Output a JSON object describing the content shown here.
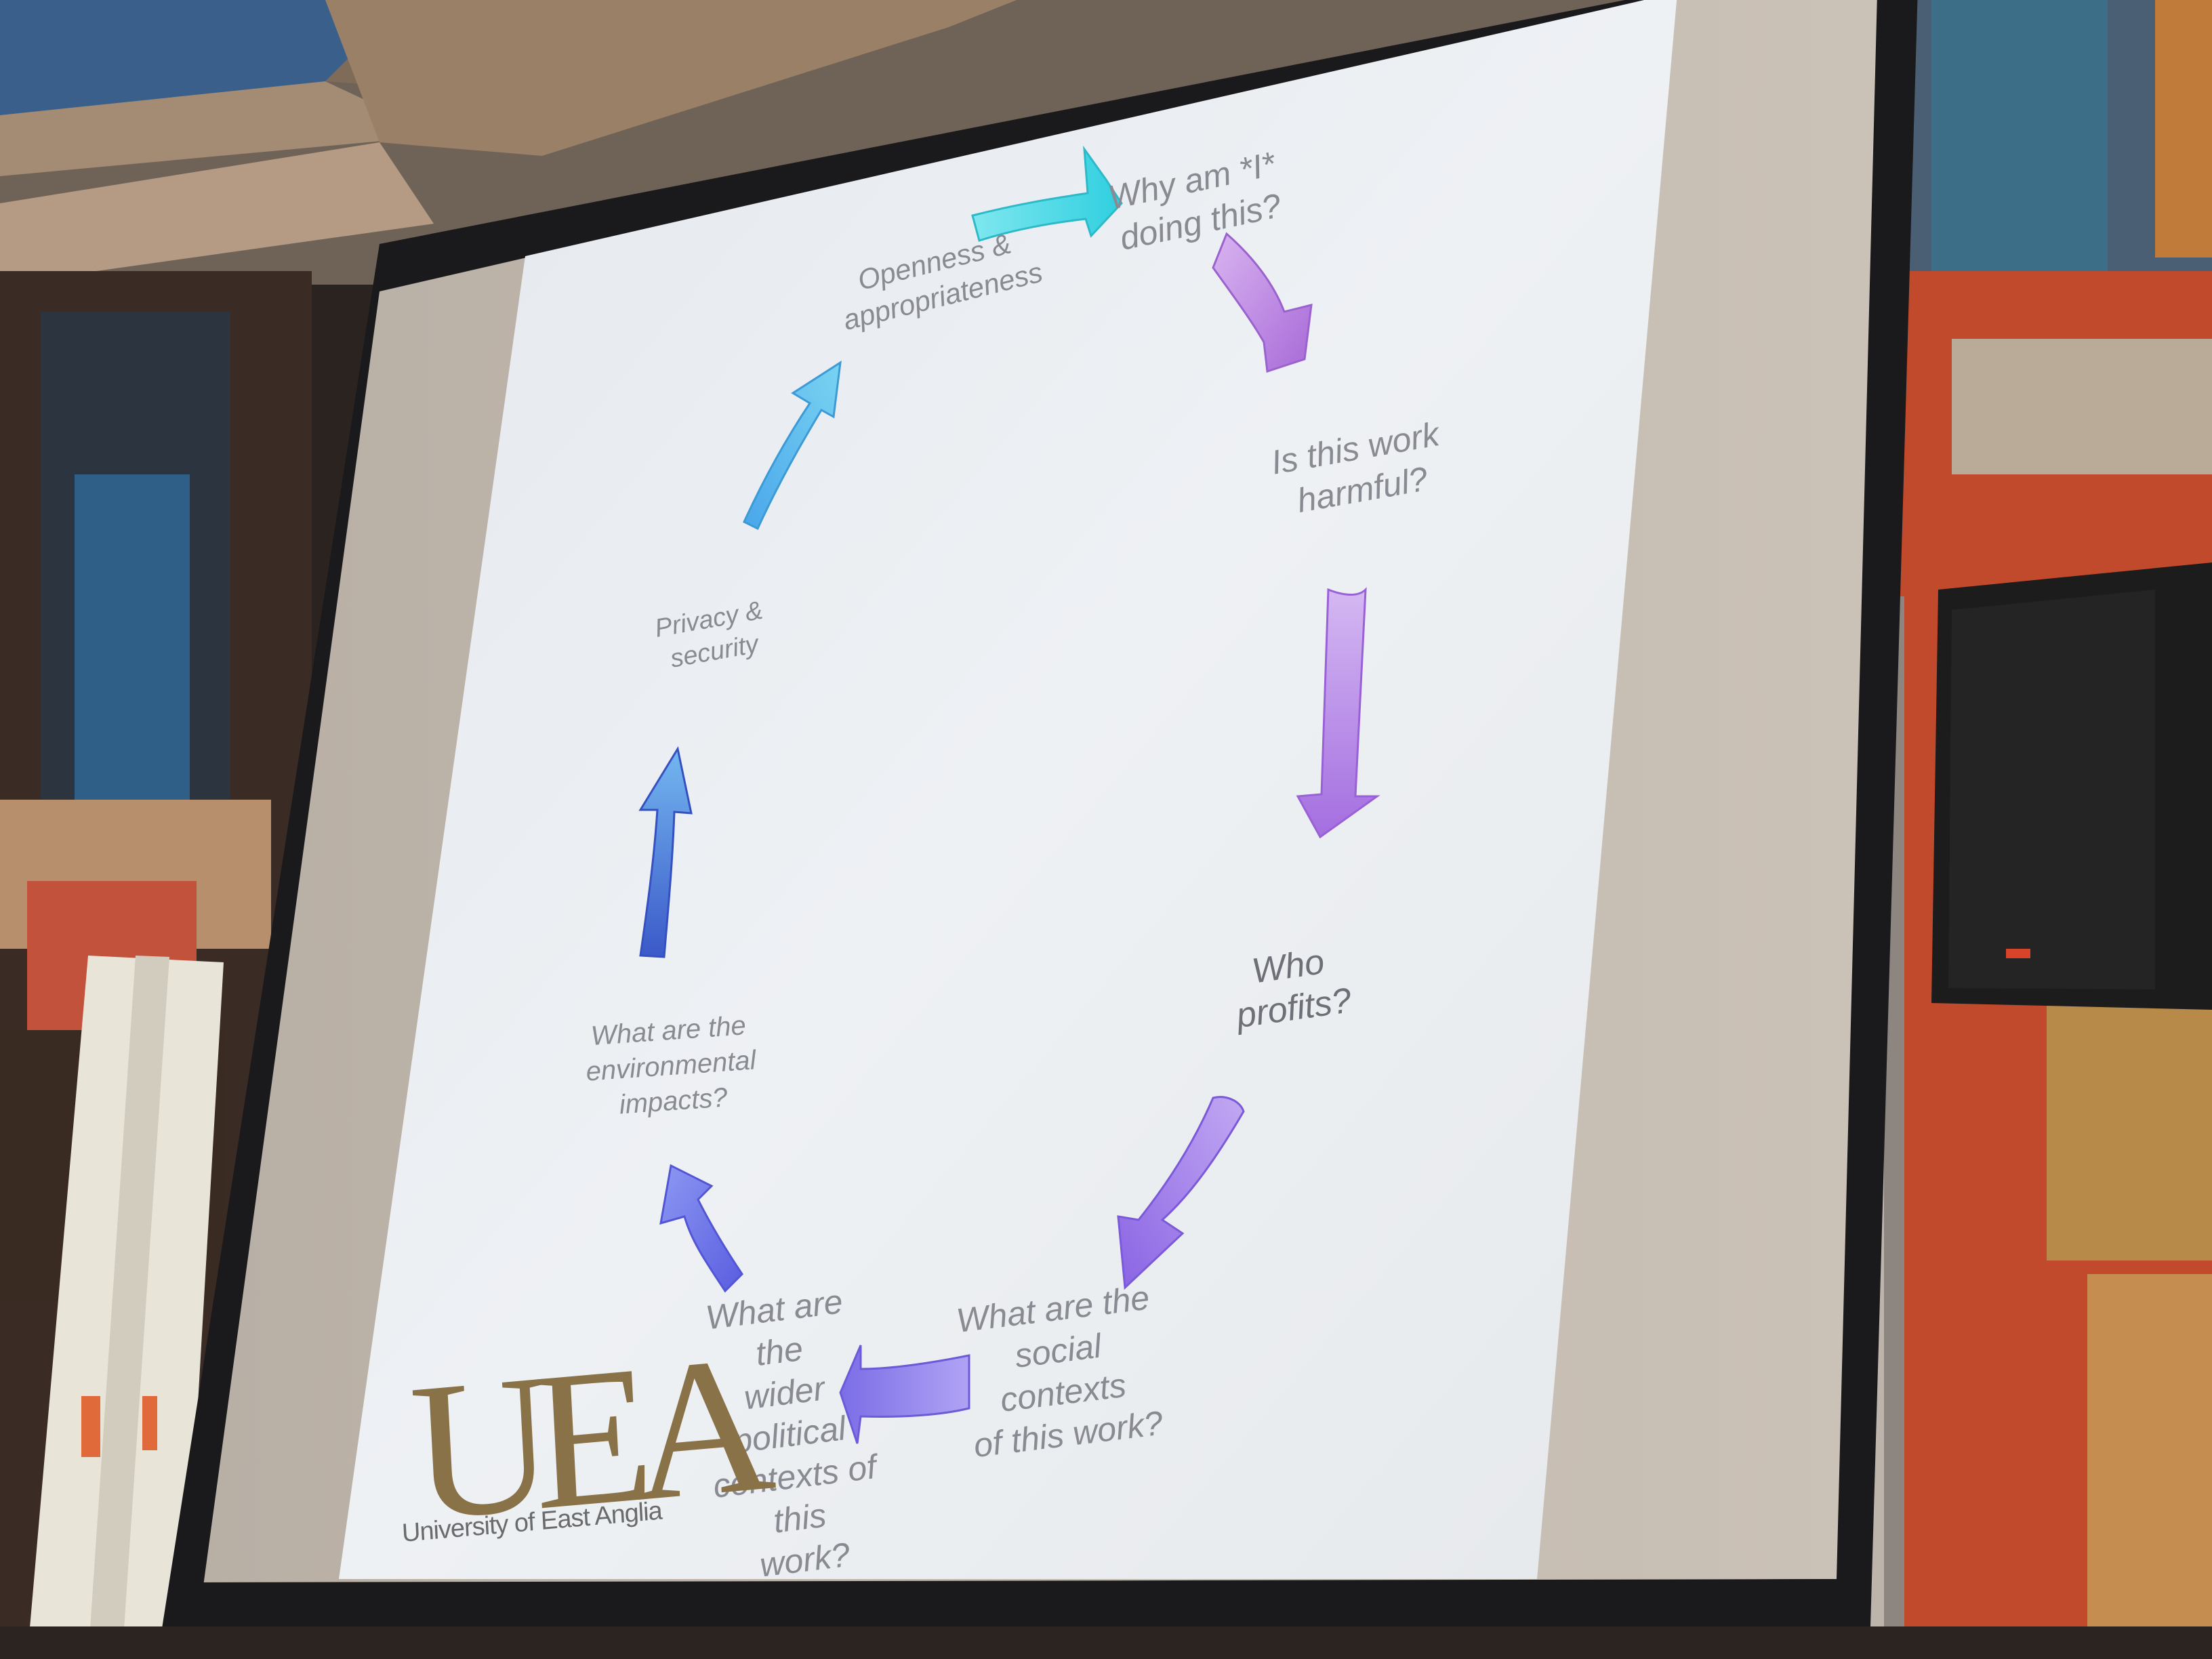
{
  "slide": {
    "labels": {
      "why_am_i": "Why am *I*\ndoing this?",
      "harmful": "Is this work\nharmful?",
      "profits": "Who profits?",
      "social": "What are the\nsocial contexts\nof this work?",
      "political": "What are the\nwider political\ncontexts of this\nwork?",
      "environmental": "What are the\nenvironmental\nimpacts?",
      "privacy": "Privacy &\nsecurity",
      "openness": "Openness &\nappropriateness"
    },
    "logo": {
      "wordmark": "UEA",
      "name": "University of East Anglia"
    }
  },
  "colors": {
    "cyan": "#3fd6e6",
    "sky": "#5ab8ee",
    "blue": "#5b7fe0",
    "indigo": "#7a7cec",
    "violet": "#a08cf0",
    "purple": "#b98ae8",
    "magenta": "#c28ae8"
  }
}
